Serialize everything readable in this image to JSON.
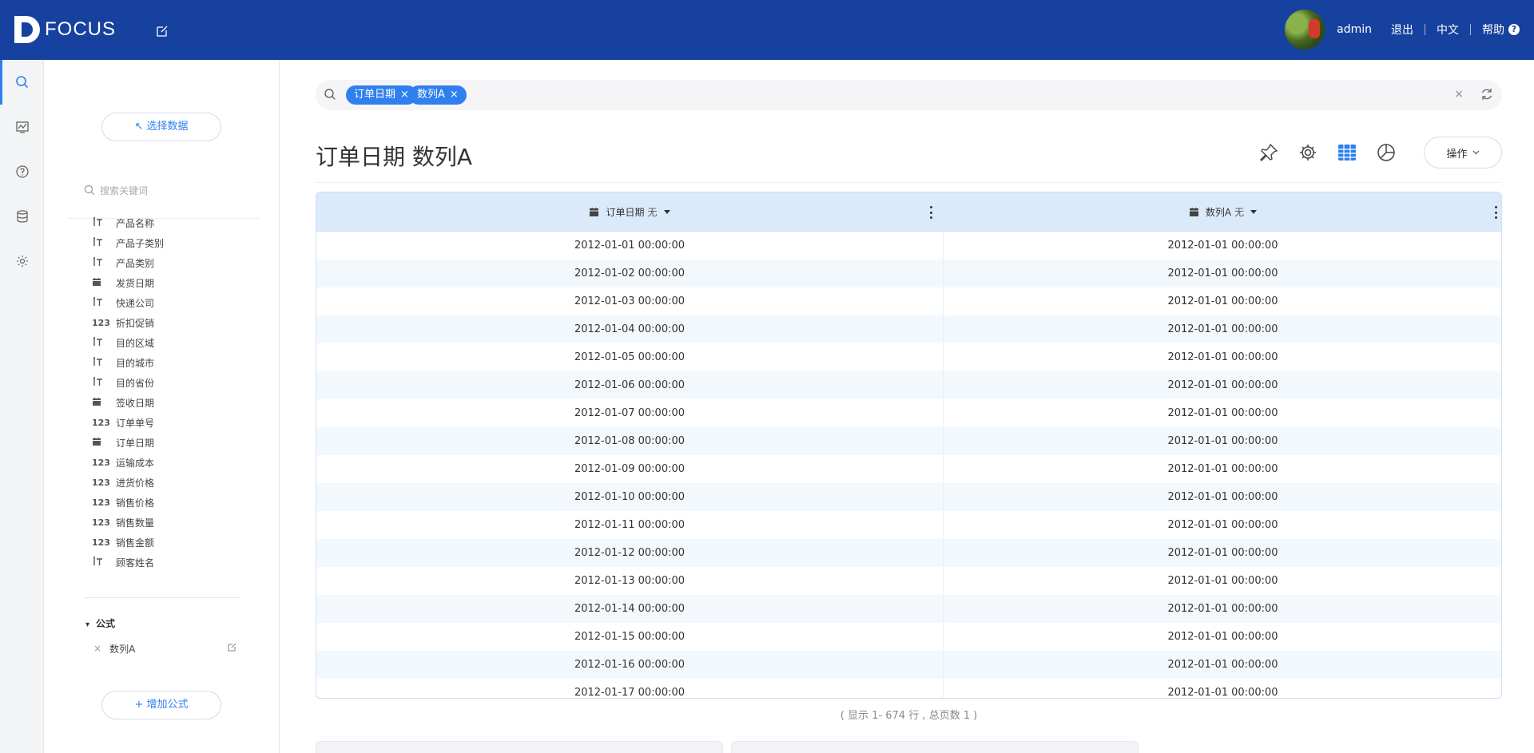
{
  "app": {
    "brand": "FOCUS",
    "user": "admin",
    "logout": "退出",
    "language": "中文",
    "help": "帮助",
    "help_icon_glyph": "?"
  },
  "rail": {
    "items": [
      "search-icon",
      "dashboard-icon",
      "help-icon",
      "database-icon",
      "settings-icon"
    ],
    "active_index": 0
  },
  "panel": {
    "select_data": "↖ 选择数据",
    "search_placeholder": "搜索关键词",
    "fields": [
      {
        "type": "text",
        "icon": "T",
        "label": "产品名称"
      },
      {
        "type": "text",
        "icon": "T",
        "label": "产品子类别"
      },
      {
        "type": "text",
        "icon": "T",
        "label": "产品类别"
      },
      {
        "type": "date",
        "icon": "cal",
        "label": "发货日期"
      },
      {
        "type": "text",
        "icon": "T",
        "label": "快递公司"
      },
      {
        "type": "number",
        "icon": "123",
        "label": "折扣促销"
      },
      {
        "type": "text",
        "icon": "T",
        "label": "目的区域"
      },
      {
        "type": "text",
        "icon": "T",
        "label": "目的城市"
      },
      {
        "type": "text",
        "icon": "T",
        "label": "目的省份"
      },
      {
        "type": "date",
        "icon": "cal",
        "label": "签收日期"
      },
      {
        "type": "number",
        "icon": "123",
        "label": "订单单号"
      },
      {
        "type": "date",
        "icon": "cal",
        "label": "订单日期"
      },
      {
        "type": "number",
        "icon": "123",
        "label": "运输成本"
      },
      {
        "type": "number",
        "icon": "123",
        "label": "进货价格"
      },
      {
        "type": "number",
        "icon": "123",
        "label": "销售价格"
      },
      {
        "type": "number",
        "icon": "123",
        "label": "销售数量"
      },
      {
        "type": "number",
        "icon": "123",
        "label": "销售金额"
      },
      {
        "type": "text",
        "icon": "T",
        "label": "顾客姓名"
      }
    ],
    "formula_header": "公式",
    "formula_caret": "▾",
    "formula_remove": "×",
    "formula_item": "数列A",
    "add_formula": "+ 增加公式"
  },
  "search": {
    "tokens": [
      "订单日期",
      "数列A"
    ],
    "token_close": "×",
    "clear": "×"
  },
  "main": {
    "title": "订单日期 数列A",
    "operations": "操作",
    "table": {
      "columns": [
        {
          "label": "订单日期",
          "agg": "无"
        },
        {
          "label": "数列A",
          "agg": "无"
        }
      ],
      "rows": [
        [
          "2012-01-01 00:00:00",
          "2012-01-01 00:00:00"
        ],
        [
          "2012-01-02 00:00:00",
          "2012-01-01 00:00:00"
        ],
        [
          "2012-01-03 00:00:00",
          "2012-01-01 00:00:00"
        ],
        [
          "2012-01-04 00:00:00",
          "2012-01-01 00:00:00"
        ],
        [
          "2012-01-05 00:00:00",
          "2012-01-01 00:00:00"
        ],
        [
          "2012-01-06 00:00:00",
          "2012-01-01 00:00:00"
        ],
        [
          "2012-01-07 00:00:00",
          "2012-01-01 00:00:00"
        ],
        [
          "2012-01-08 00:00:00",
          "2012-01-01 00:00:00"
        ],
        [
          "2012-01-09 00:00:00",
          "2012-01-01 00:00:00"
        ],
        [
          "2012-01-10 00:00:00",
          "2012-01-01 00:00:00"
        ],
        [
          "2012-01-11 00:00:00",
          "2012-01-01 00:00:00"
        ],
        [
          "2012-01-12 00:00:00",
          "2012-01-01 00:00:00"
        ],
        [
          "2012-01-13 00:00:00",
          "2012-01-01 00:00:00"
        ],
        [
          "2012-01-14 00:00:00",
          "2012-01-01 00:00:00"
        ],
        [
          "2012-01-15 00:00:00",
          "2012-01-01 00:00:00"
        ],
        [
          "2012-01-16 00:00:00",
          "2012-01-01 00:00:00"
        ],
        [
          "2012-01-17 00:00:00",
          "2012-01-01 00:00:00"
        ]
      ]
    },
    "footer": "( 显示 1- 674 行 , 总页数 1 )"
  },
  "colors": {
    "topbar": "#17419e",
    "accent": "#2f80ed",
    "header_row": "#dbeafa"
  }
}
